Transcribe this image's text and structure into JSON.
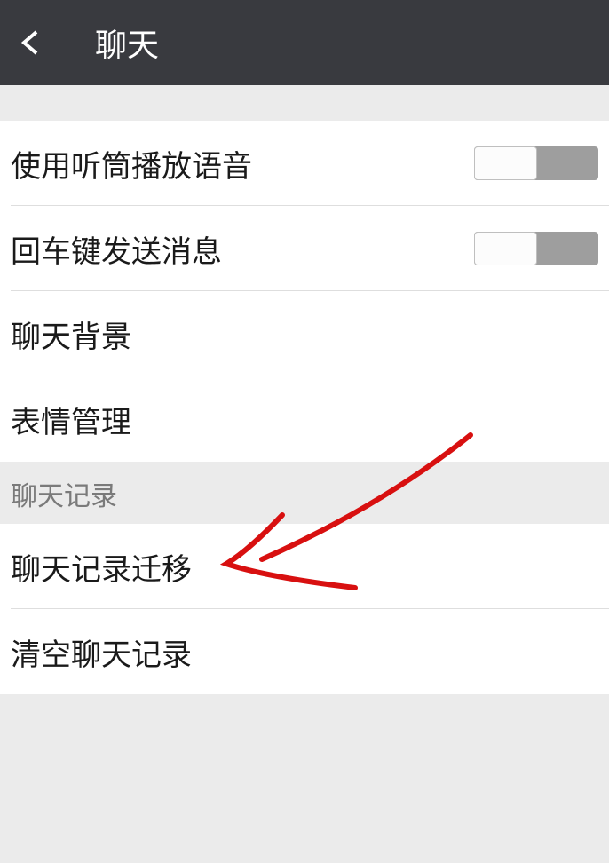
{
  "header": {
    "title": "聊天"
  },
  "group1": {
    "items": [
      {
        "label": "使用听筒播放语音",
        "hasToggle": true
      },
      {
        "label": "回车键发送消息",
        "hasToggle": true
      },
      {
        "label": "聊天背景",
        "hasToggle": false
      },
      {
        "label": "表情管理",
        "hasToggle": false
      }
    ]
  },
  "section2": {
    "header": "聊天记录"
  },
  "group2": {
    "items": [
      {
        "label": "聊天记录迁移"
      },
      {
        "label": "清空聊天记录"
      }
    ]
  }
}
